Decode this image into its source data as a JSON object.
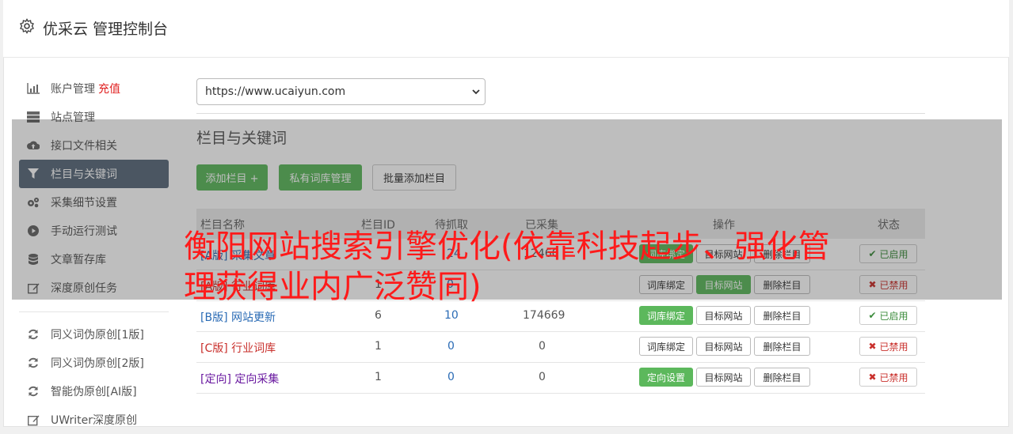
{
  "header": {
    "title": "优采云 管理控制台",
    "icon": "gear-icon"
  },
  "sidebar": {
    "items": [
      {
        "label": "账户管理",
        "extra": "充值",
        "icon": "bar-chart-icon"
      },
      {
        "label": "站点管理",
        "icon": "server-icon"
      },
      {
        "label": "接口文件相关",
        "icon": "cloud-upload-icon"
      },
      {
        "label": "栏目与关键词",
        "icon": "filter-icon",
        "active": true
      },
      {
        "label": "采集细节设置",
        "icon": "cogs-icon"
      },
      {
        "label": "手动运行测试",
        "icon": "play-circle-icon"
      },
      {
        "label": "文章暂存库",
        "icon": "database-icon"
      },
      {
        "label": "深度原创任务",
        "icon": "edit-icon"
      }
    ],
    "items2": [
      {
        "label": "同义词伪原创[1版]",
        "icon": "refresh-icon"
      },
      {
        "label": "同义词伪原创[2版]",
        "icon": "refresh-icon"
      },
      {
        "label": "智能伪原创[AI版]",
        "icon": "refresh-icon"
      },
      {
        "label": "UWriter深度原创",
        "icon": "edit-icon"
      }
    ]
  },
  "site_select": {
    "value": "https://www.ucaiyun.com"
  },
  "section_title": "栏目与关键词",
  "toolbar": {
    "add_label": "添加栏目 +",
    "private_label": "私有词库管理",
    "batch_label": "批量添加栏目"
  },
  "table": {
    "headers": [
      "栏目名称",
      "栏目ID",
      "待抓取",
      "已采集",
      "操作",
      "状态"
    ],
    "rows": [
      {
        "tag": "",
        "name": "[A版] 采集文章",
        "id": "",
        "pending": "24",
        "collected": "12460",
        "op1": "词库绑定",
        "op2": "目标网站",
        "op3": "删除栏目",
        "status": "已启用",
        "on": true
      },
      {
        "tag": "",
        "name": "[A版] 行业词库",
        "id": "1",
        "pending": "0",
        "collected": "",
        "op1": "词库绑定",
        "op2": "目标网站",
        "op3": "删除栏目",
        "status": "已禁用",
        "on": false
      },
      {
        "tag": "[B版]",
        "name": "网站更新",
        "id": "6",
        "pending": "10",
        "collected": "174669",
        "op1": "词库绑定",
        "op2": "目标网站",
        "op3": "删除栏目",
        "status": "已启用",
        "on": true
      },
      {
        "tag": "[C版]",
        "name": "行业词库",
        "id": "1",
        "pending": "0",
        "collected": "0",
        "op1": "词库绑定",
        "op2": "目标网站",
        "op3": "删除栏目",
        "status": "已禁用",
        "on": false
      },
      {
        "tag": "[定向]",
        "name": "定向采集",
        "id": "1",
        "pending": "0",
        "collected": "0",
        "op1": "定向设置",
        "op2": "目标网站",
        "op3": "删除栏目",
        "status": "已禁用",
        "on": false
      }
    ]
  },
  "overlay_text": "衡阳网站搜索引擎优化(依靠科技起步、强化管理获得业内广泛赞同)",
  "colors": {
    "green": "#5cb85c",
    "active_bg": "#5b6b7c",
    "red": "#e02020",
    "link_blue": "#2a6bb5"
  }
}
